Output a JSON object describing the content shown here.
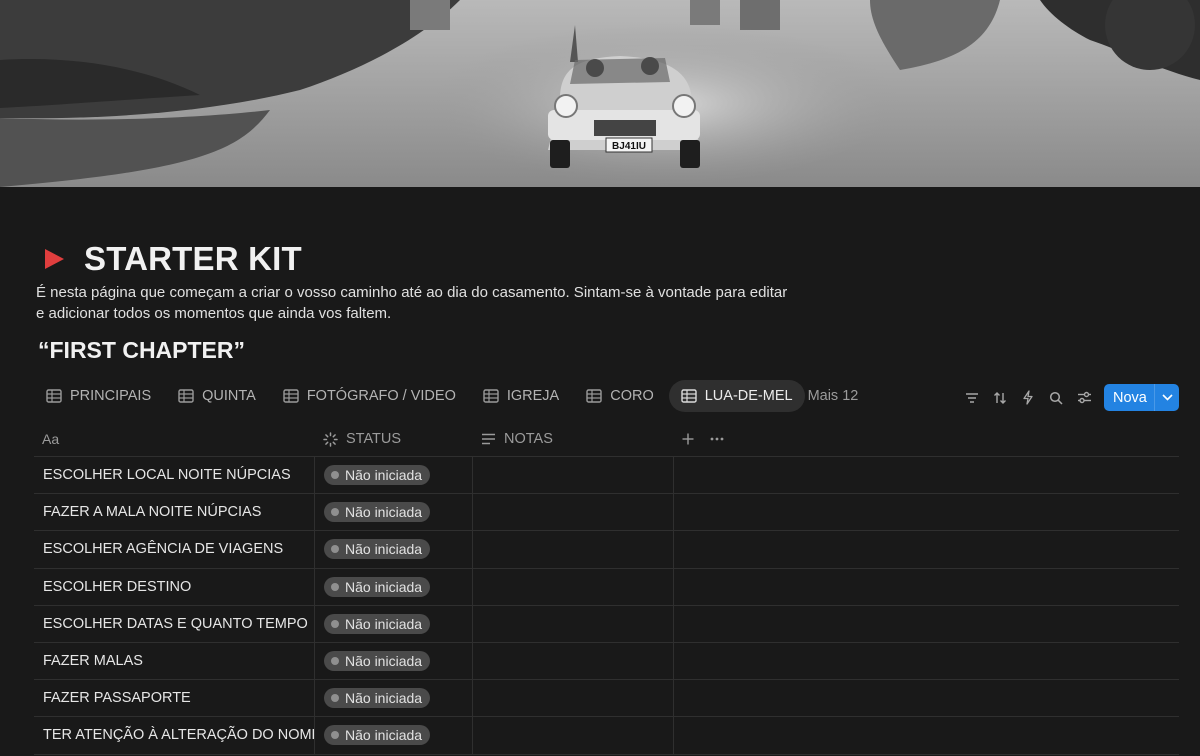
{
  "page": {
    "title": "STARTER KIT",
    "description": "É nesta página que começam a criar o vosso caminho até ao dia do casamento. Sintam-se à vontade para editar e adicionar todos os momentos que ainda vos faltem.",
    "section_heading": "“FIRST CHAPTER”",
    "title_icon": "play-icon",
    "accent_color": "#e03e3e"
  },
  "cover": {
    "plate_text": "BJ41IU"
  },
  "tabs": [
    {
      "label": "PRINCIPAIS",
      "icon": "table-icon",
      "active": false
    },
    {
      "label": "QUINTA",
      "icon": "table-icon",
      "active": false
    },
    {
      "label": "FOTÓGRAFO / VIDEO",
      "icon": "table-icon",
      "active": false
    },
    {
      "label": "IGREJA",
      "icon": "table-icon",
      "active": false
    },
    {
      "label": "CORO",
      "icon": "table-icon",
      "active": false
    },
    {
      "label": "LUA-DE-MEL",
      "icon": "table-icon",
      "active": true
    }
  ],
  "tabs_more": "Mais 12",
  "toolbar": {
    "new_label": "Nova",
    "new_color": "#2383e2"
  },
  "table": {
    "headers": {
      "name": "Aa",
      "status": "STATUS",
      "notes": "NOTAS"
    },
    "rows": [
      {
        "name": "ESCOLHER LOCAL NOITE NÚPCIAS",
        "status": "Não iniciada",
        "notes": ""
      },
      {
        "name": "FAZER A MALA NOITE NÚPCIAS",
        "status": "Não iniciada",
        "notes": ""
      },
      {
        "name": "ESCOLHER AGÊNCIA DE VIAGENS",
        "status": "Não iniciada",
        "notes": ""
      },
      {
        "name": "ESCOLHER DESTINO",
        "status": "Não iniciada",
        "notes": ""
      },
      {
        "name": "ESCOLHER DATAS E QUANTO TEMPO",
        "status": "Não iniciada",
        "notes": ""
      },
      {
        "name": "FAZER MALAS",
        "status": "Não iniciada",
        "notes": ""
      },
      {
        "name": "FAZER PASSAPORTE",
        "status": "Não iniciada",
        "notes": ""
      },
      {
        "name": "TER ATENÇÃO À ALTERAÇÃO DO NOME",
        "status": "Não iniciada",
        "notes": ""
      }
    ]
  }
}
